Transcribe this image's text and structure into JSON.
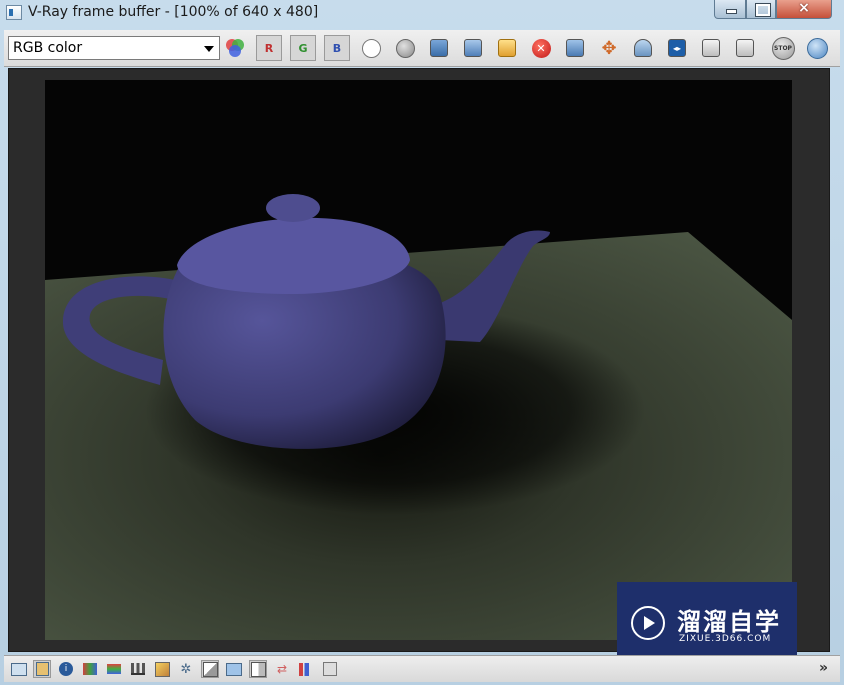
{
  "window": {
    "title": "V-Ray frame buffer - [100% of 640 x 480]",
    "controls": {
      "minimize": "minimize-icon",
      "maximize": "maximize-icon",
      "close": "×"
    }
  },
  "toolbar": {
    "channel_select": {
      "value": "RGB color"
    },
    "buttons": [
      {
        "name": "color-channels-icon"
      },
      {
        "name": "red-channel-toggle",
        "label": "R"
      },
      {
        "name": "green-channel-toggle",
        "label": "G"
      },
      {
        "name": "blue-channel-toggle",
        "label": "B"
      },
      {
        "name": "white-display-icon"
      },
      {
        "name": "alpha-display-icon"
      },
      {
        "name": "save-image-icon"
      },
      {
        "name": "save-all-channels-icon"
      },
      {
        "name": "load-image-icon"
      },
      {
        "name": "clear-image-icon"
      },
      {
        "name": "duplicate-to-max-fb-icon"
      },
      {
        "name": "track-mouse-render-icon"
      },
      {
        "name": "region-render-icon"
      },
      {
        "name": "link-to-max-fb-icon"
      },
      {
        "name": "show-corrections-icon"
      },
      {
        "name": "show-history-icon"
      },
      {
        "name": "stop-render-icon",
        "label": "STOP"
      },
      {
        "name": "render-last-icon"
      }
    ]
  },
  "watermark": {
    "title": "溜溜自学",
    "subtitle": "ZIXUE.3D66.COM"
  },
  "bottombar": {
    "buttons": [
      "display-panel-icon",
      "color-corrections-icon",
      "info-icon",
      "pixel-info-icon",
      "levels-icon",
      "histogram-icon",
      "curve-icon",
      "settings-icon",
      "compare-ab-icon",
      "display-lut-icon",
      "horizontal-split-icon",
      "h-icon",
      "swap-icon",
      "bars-icon",
      "extra-icon"
    ],
    "collapse": "»"
  },
  "colors": {
    "teapot": "#4b4a86",
    "floor": "#4c5644",
    "background": "#050505",
    "watermark_bg": "#1e2f6b"
  }
}
